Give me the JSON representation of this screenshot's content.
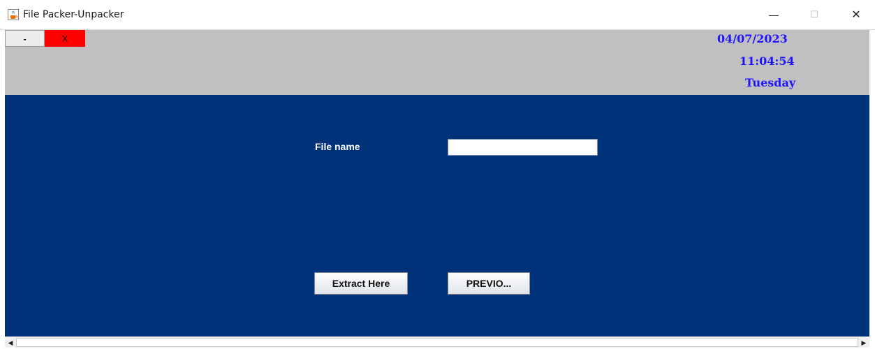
{
  "window": {
    "title": "File Packer-Unpacker",
    "icon": "java-cup-icon",
    "controls": {
      "minimize": "—",
      "maximize": "☐",
      "close": "✕"
    }
  },
  "header": {
    "minimize_label": "-",
    "exit_label": "X",
    "date": "04/07/2023",
    "time": "11:04:54",
    "day": "Tuesday",
    "clock_color": "#1f14ff",
    "background": "#c0c0c0",
    "exit_color": "#ff0000"
  },
  "form": {
    "file_name_label": "File name",
    "file_name_value": "",
    "extract_label": "Extract Here",
    "previous_label": "PREVIO...",
    "background": "#00327a"
  },
  "scrollbar": {
    "left_arrow": "◀",
    "right_arrow": "▶"
  }
}
